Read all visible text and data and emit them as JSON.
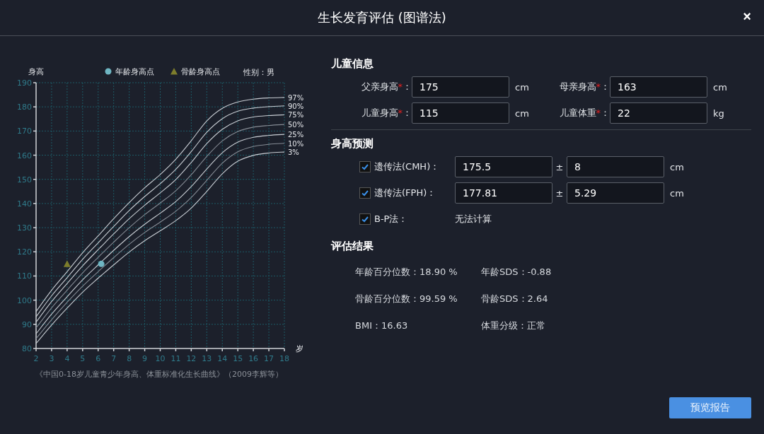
{
  "window": {
    "title": "生长发育评估 (图谱法)",
    "close": "×"
  },
  "chart": {
    "y_title": "身高",
    "x_title": "岁",
    "sex": "性别：男",
    "caption": "《中国0-18岁儿童青少年身高、体重标准化生长曲线》（2009李辉等）",
    "chart_data": {
      "type": "line",
      "grid": true,
      "legend": "top",
      "x": [
        2,
        3,
        4,
        5,
        6,
        6.2,
        7,
        8,
        9,
        10,
        11,
        12,
        13,
        14,
        15,
        16,
        17,
        18
      ],
      "xlim": [
        2,
        18
      ],
      "ylim": [
        80,
        190
      ],
      "xticks": [
        2,
        3,
        4,
        5,
        6,
        7,
        8,
        9,
        10,
        11,
        12,
        13,
        14,
        15,
        16,
        17,
        18
      ],
      "yticks": [
        80,
        90,
        100,
        110,
        120,
        130,
        140,
        150,
        160,
        170,
        180,
        190
      ],
      "series": [
        {
          "name": "97%",
          "color": "#c8cdd3",
          "values": [
            95.3,
            104.1,
            111.8,
            119.6,
            126.6,
            128.0,
            133.7,
            140.4,
            146.5,
            152.0,
            158.3,
            166.0,
            174.2,
            179.4,
            182.0,
            183.2,
            183.7,
            183.9
          ]
        },
        {
          "name": "90%",
          "color": "#c8cdd3",
          "values": [
            93.1,
            101.8,
            109.3,
            116.9,
            123.7,
            125.1,
            130.5,
            137.1,
            142.9,
            148.2,
            154.1,
            161.5,
            169.5,
            175.1,
            178.2,
            179.5,
            180.1,
            180.4
          ]
        },
        {
          "name": "75%",
          "color": "#c8cdd3",
          "values": [
            90.9,
            99.4,
            106.9,
            114.2,
            120.9,
            122.2,
            127.4,
            133.7,
            139.3,
            144.4,
            149.9,
            157.0,
            164.8,
            170.7,
            174.2,
            175.8,
            176.4,
            176.7
          ]
        },
        {
          "name": "50%",
          "color": "#858b94",
          "values": [
            88.5,
            96.8,
            104.1,
            111.3,
            117.7,
            119.0,
            124.0,
            130.0,
            135.4,
            140.2,
            145.3,
            151.9,
            159.5,
            165.9,
            169.8,
            171.6,
            172.3,
            172.7
          ]
        },
        {
          "name": "25%",
          "color": "#c8cdd3",
          "values": [
            86.1,
            94.2,
            101.4,
            108.4,
            114.6,
            115.8,
            120.6,
            126.3,
            131.4,
            136.0,
            140.8,
            147.0,
            154.3,
            161.0,
            165.4,
            167.4,
            168.2,
            168.6
          ]
        },
        {
          "name": "10%",
          "color": "#858b94",
          "values": [
            84.1,
            91.9,
            99.1,
            105.8,
            111.8,
            113.0,
            117.6,
            123.1,
            128.0,
            132.3,
            136.8,
            142.5,
            149.6,
            156.7,
            161.4,
            163.6,
            164.5,
            164.9
          ]
        },
        {
          "name": "3%",
          "color": "#c8cdd3",
          "values": [
            82.1,
            89.7,
            96.7,
            103.3,
            109.1,
            110.2,
            114.6,
            119.9,
            124.6,
            128.7,
            132.9,
            138.1,
            145.0,
            152.3,
            157.5,
            159.9,
            160.9,
            161.3
          ]
        },
        {
          "name": "年龄身高点",
          "color": "#6fb6c3",
          "marker": "circle",
          "values": [
            null,
            null,
            null,
            null,
            null,
            115,
            null,
            null,
            null,
            null,
            null,
            null,
            null,
            null,
            null,
            null,
            null,
            null
          ]
        },
        {
          "name": "骨龄身高点",
          "color": "#7d7d2c",
          "marker": "triangle",
          "values": [
            null,
            null,
            115,
            null,
            null,
            null,
            null,
            null,
            null,
            null,
            null,
            null,
            null,
            null,
            null,
            null,
            null,
            null
          ]
        }
      ]
    }
  },
  "info": {
    "title": "儿童信息",
    "fields": [
      {
        "label": "父亲身高",
        "mark": "*",
        "colon": "：",
        "value": "175",
        "unit": "cm"
      },
      {
        "label": "母亲身高",
        "mark": "*",
        "colon": "：",
        "value": "163",
        "unit": "cm"
      },
      {
        "label": "儿童身高",
        "mark": "*",
        "colon": "：",
        "value": "115",
        "unit": "cm"
      },
      {
        "label": "儿童体重",
        "mark": "*",
        "colon": "：",
        "value": "22",
        "unit": "kg"
      }
    ]
  },
  "prediction": {
    "title": "身高预测",
    "rows": [
      {
        "kind": "range",
        "label": "遗传法(CMH)：",
        "checked": true,
        "value": "175.5",
        "pm": "±",
        "error": "8",
        "unit": "cm"
      },
      {
        "kind": "range",
        "label": "遗传法(FPH)：",
        "checked": true,
        "value": "177.81",
        "pm": "±",
        "error": "5.29",
        "unit": "cm"
      },
      {
        "kind": "text",
        "label": "B-P法：",
        "checked": true,
        "value": "无法计算"
      }
    ]
  },
  "results": {
    "title": "评估结果",
    "items": [
      "年龄百分位数：18.90 %",
      "年龄SDS：-0.88",
      "骨龄百分位数：99.59 %",
      "骨龄SDS：2.64",
      "BMI：16.63",
      "体重分级：正常"
    ]
  },
  "button": "预览报告"
}
